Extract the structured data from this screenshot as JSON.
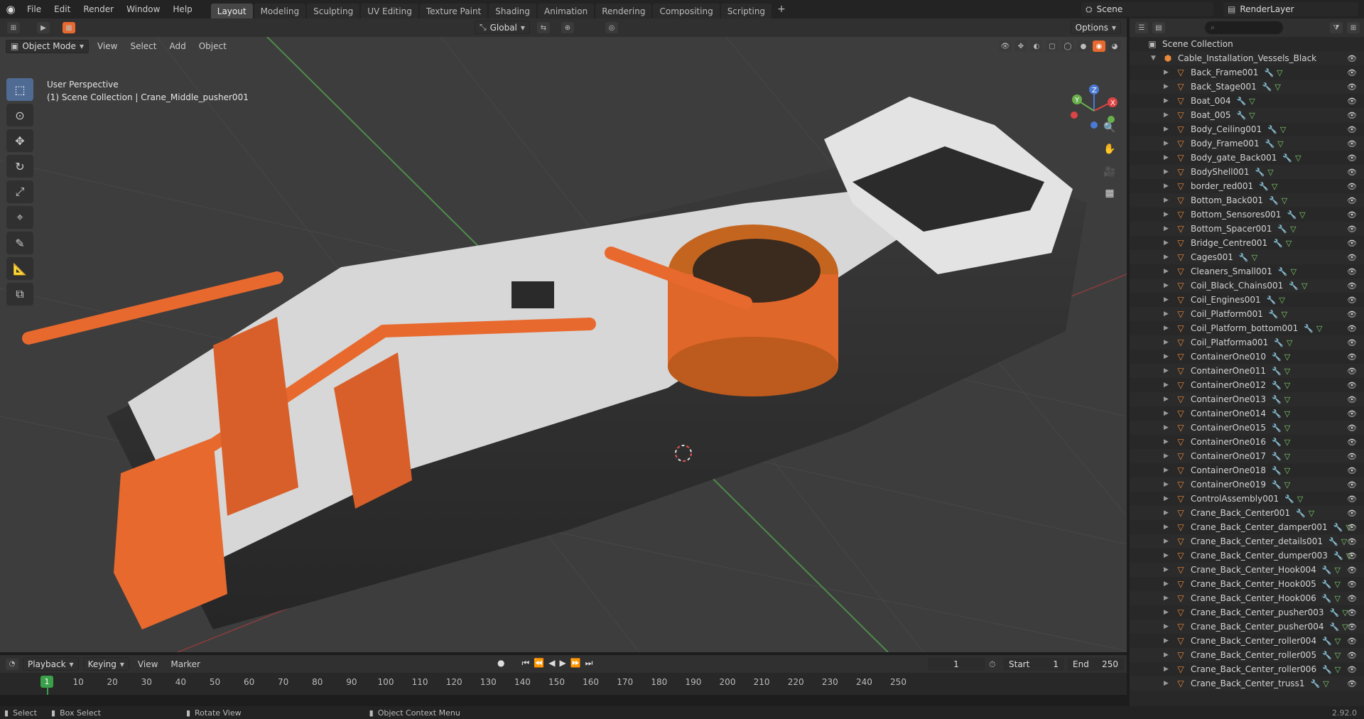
{
  "menu": [
    "File",
    "Edit",
    "Render",
    "Window",
    "Help"
  ],
  "workspaces": [
    "Layout",
    "Modeling",
    "Sculpting",
    "UV Editing",
    "Texture Paint",
    "Shading",
    "Animation",
    "Rendering",
    "Compositing",
    "Scripting"
  ],
  "active_workspace": "Layout",
  "scene": "Scene",
  "render_layer": "RenderLayer",
  "viewport": {
    "mode": "Object Mode",
    "menus": [
      "View",
      "Select",
      "Add",
      "Object"
    ],
    "orientation": "Global",
    "options": "Options",
    "perspective": "User Perspective",
    "collection_path": "(1) Scene Collection | Crane_Middle_pusher001"
  },
  "outliner": {
    "root": "Scene Collection",
    "collection": "Cable_Installation_Vessels_Black",
    "items": [
      "Back_Frame001",
      "Back_Stage001",
      "Boat_004",
      "Boat_005",
      "Body_Ceiling001",
      "Body_Frame001",
      "Body_gate_Back001",
      "BodyShell001",
      "border_red001",
      "Bottom_Back001",
      "Bottom_Sensores001",
      "Bottom_Spacer001",
      "Bridge_Centre001",
      "Cages001",
      "Cleaners_Small001",
      "Coil_Black_Chains001",
      "Coil_Engines001",
      "Coil_Platform001",
      "Coil_Platform_bottom001",
      "Coil_Platforma001",
      "ContainerOne010",
      "ContainerOne011",
      "ContainerOne012",
      "ContainerOne013",
      "ContainerOne014",
      "ContainerOne015",
      "ContainerOne016",
      "ContainerOne017",
      "ContainerOne018",
      "ContainerOne019",
      "ControlAssembly001",
      "Crane_Back_Center001",
      "Crane_Back_Center_damper001",
      "Crane_Back_Center_details001",
      "Crane_Back_Center_dumper003",
      "Crane_Back_Center_Hook004",
      "Crane_Back_Center_Hook005",
      "Crane_Back_Center_Hook006",
      "Crane_Back_Center_pusher003",
      "Crane_Back_Center_pusher004",
      "Crane_Back_Center_roller004",
      "Crane_Back_Center_roller005",
      "Crane_Back_Center_roller006",
      "Crane_Back_Center_truss1"
    ]
  },
  "timeline": {
    "menus": [
      "Playback",
      "Keying",
      "View",
      "Marker"
    ],
    "current_frame": "1",
    "start_label": "Start",
    "start": "1",
    "end_label": "End",
    "end": "250",
    "ticks": [
      "10",
      "20",
      "30",
      "40",
      "50",
      "60",
      "70",
      "80",
      "90",
      "100",
      "110",
      "120",
      "130",
      "140",
      "150",
      "160",
      "170",
      "180",
      "190",
      "200",
      "210",
      "220",
      "230",
      "240",
      "250"
    ]
  },
  "status": {
    "select": "Select",
    "box_select": "Box Select",
    "rotate": "Rotate View",
    "context": "Object Context Menu",
    "version": "2.92.0"
  },
  "colors": {
    "accent_orange": "#e8692e",
    "active_blue": "#4f6b93",
    "frame_green": "#3aa04a"
  }
}
